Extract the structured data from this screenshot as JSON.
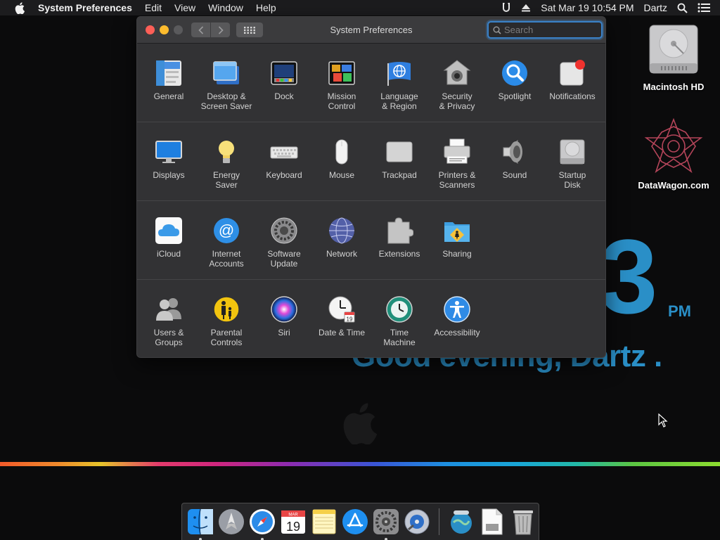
{
  "menubar": {
    "app_name": "System Preferences",
    "menus": [
      "Edit",
      "View",
      "Window",
      "Help"
    ],
    "datetime": "Sat Mar 19  10:54 PM",
    "user": "Dartz"
  },
  "desktop": {
    "clock_digit": "3",
    "clock_ampm": "PM",
    "greeting": "Good evening, Dartz .",
    "icons": [
      {
        "label": "Macintosh HD"
      },
      {
        "label": "DataWagon.com"
      }
    ]
  },
  "window": {
    "title": "System Preferences",
    "search_placeholder": "Search",
    "rows": [
      [
        {
          "label": "General",
          "icon": "general-icon"
        },
        {
          "label": "Desktop &\nScreen Saver",
          "icon": "desktop-screensaver-icon"
        },
        {
          "label": "Dock",
          "icon": "dock-icon"
        },
        {
          "label": "Mission\nControl",
          "icon": "mission-control-icon"
        },
        {
          "label": "Language\n& Region",
          "icon": "language-region-icon"
        },
        {
          "label": "Security\n& Privacy",
          "icon": "security-privacy-icon"
        },
        {
          "label": "Spotlight",
          "icon": "spotlight-icon"
        },
        {
          "label": "Notifications",
          "icon": "notifications-icon"
        }
      ],
      [
        {
          "label": "Displays",
          "icon": "displays-icon"
        },
        {
          "label": "Energy\nSaver",
          "icon": "energy-saver-icon"
        },
        {
          "label": "Keyboard",
          "icon": "keyboard-icon"
        },
        {
          "label": "Mouse",
          "icon": "mouse-icon"
        },
        {
          "label": "Trackpad",
          "icon": "trackpad-icon"
        },
        {
          "label": "Printers &\nScanners",
          "icon": "printers-scanners-icon"
        },
        {
          "label": "Sound",
          "icon": "sound-icon"
        },
        {
          "label": "Startup\nDisk",
          "icon": "startup-disk-icon"
        }
      ],
      [
        {
          "label": "iCloud",
          "icon": "icloud-icon"
        },
        {
          "label": "Internet\nAccounts",
          "icon": "internet-accounts-icon"
        },
        {
          "label": "Software\nUpdate",
          "icon": "software-update-icon"
        },
        {
          "label": "Network",
          "icon": "network-icon"
        },
        {
          "label": "Extensions",
          "icon": "extensions-icon"
        },
        {
          "label": "Sharing",
          "icon": "sharing-icon"
        }
      ],
      [
        {
          "label": "Users &\nGroups",
          "icon": "users-groups-icon"
        },
        {
          "label": "Parental\nControls",
          "icon": "parental-controls-icon"
        },
        {
          "label": "Siri",
          "icon": "siri-icon"
        },
        {
          "label": "Date & Time",
          "icon": "date-time-icon"
        },
        {
          "label": "Time\nMachine",
          "icon": "time-machine-icon"
        },
        {
          "label": "Accessibility",
          "icon": "accessibility-icon"
        }
      ]
    ]
  },
  "dock": {
    "items": [
      "finder-icon",
      "launchpad-icon",
      "safari-icon",
      "calendar-icon",
      "notes-icon",
      "app-store-icon",
      "system-preferences-icon",
      "disk-utility-icon",
      "network-globe-icon",
      "preview-document-icon",
      "trash-icon"
    ],
    "calendar_month": "MAR",
    "calendar_day": "19"
  },
  "colors": {
    "accent": "#2a8fc7",
    "close": "#fe5f57",
    "minimize": "#febc2e"
  }
}
